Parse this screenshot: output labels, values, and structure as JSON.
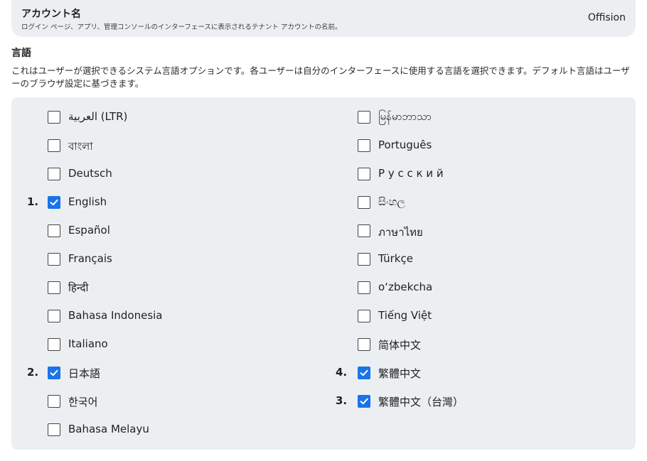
{
  "account": {
    "title": "アカウント名",
    "description": "ログイン ページ、アプリ、管理コンソールのインターフェースに表示されるテナント アカウントの名前。",
    "value": "Offision"
  },
  "language": {
    "heading": "言語",
    "description": "これはユーザーが選択できるシステム言語オプションです。各ユーザーは自分のインターフェースに使用する言語を選択できます。デフォルト言語はユーザーのブラウザ設定に基づきます。"
  },
  "options_left": [
    {
      "label": "العربية (LTR)",
      "checked": false,
      "order": ""
    },
    {
      "label": "বাংলা",
      "checked": false,
      "order": ""
    },
    {
      "label": "Deutsch",
      "checked": false,
      "order": ""
    },
    {
      "label": "English",
      "checked": true,
      "order": "1."
    },
    {
      "label": "Español",
      "checked": false,
      "order": ""
    },
    {
      "label": "Français",
      "checked": false,
      "order": ""
    },
    {
      "label": "हिन्दी",
      "checked": false,
      "order": ""
    },
    {
      "label": "Bahasa Indonesia",
      "checked": false,
      "order": ""
    },
    {
      "label": "Italiano",
      "checked": false,
      "order": ""
    },
    {
      "label": "日本語",
      "checked": true,
      "order": "2."
    },
    {
      "label": "한국어",
      "checked": false,
      "order": ""
    },
    {
      "label": "Bahasa Melayu",
      "checked": false,
      "order": ""
    }
  ],
  "options_right": [
    {
      "label": "မြန်မာဘာသာ",
      "checked": false,
      "order": ""
    },
    {
      "label": "Português",
      "checked": false,
      "order": ""
    },
    {
      "label": "Р у с с к и й",
      "checked": false,
      "order": ""
    },
    {
      "label": "සිංහල",
      "checked": false,
      "order": ""
    },
    {
      "label": "ภาษาไทย",
      "checked": false,
      "order": ""
    },
    {
      "label": "Türkçe",
      "checked": false,
      "order": ""
    },
    {
      "label": "o‘zbekcha",
      "checked": false,
      "order": ""
    },
    {
      "label": "Tiếng Việt",
      "checked": false,
      "order": ""
    },
    {
      "label": "简体中文",
      "checked": false,
      "order": ""
    },
    {
      "label": "繁體中文",
      "checked": true,
      "order": "4."
    },
    {
      "label": "繁體中文（台灣）",
      "checked": true,
      "order": "3."
    }
  ],
  "colors": {
    "accent": "#1a73e8",
    "panel": "#eceff2"
  },
  "icons": {
    "checked": "checkmark-icon"
  }
}
